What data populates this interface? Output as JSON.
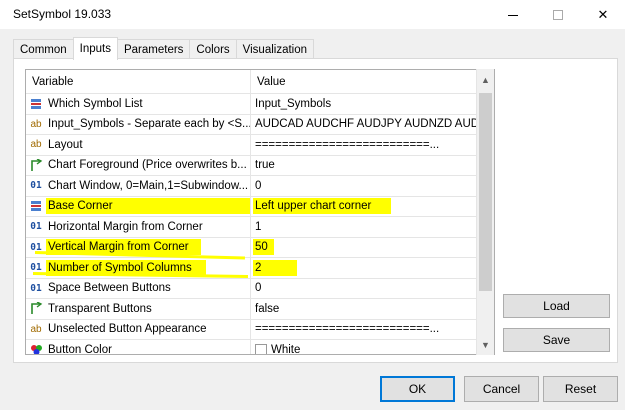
{
  "window": {
    "title": "SetSymbol 19.033",
    "minimize_icon": "minimize-icon",
    "maximize_icon": "maximize-icon",
    "close_icon": "close-icon",
    "close_glyph": "✕"
  },
  "tabs": [
    {
      "label": "Common",
      "active": false
    },
    {
      "label": "Inputs",
      "active": true
    },
    {
      "label": "Parameters",
      "active": false
    },
    {
      "label": "Colors",
      "active": false
    },
    {
      "label": "Visualization",
      "active": false
    }
  ],
  "grid": {
    "header_variable": "Variable",
    "header_value": "Value",
    "rows": [
      {
        "icon": "list-icon",
        "variable": "Which Symbol List",
        "value": "Input_Symbols"
      },
      {
        "icon": "ab",
        "variable": "Input_Symbols - Separate each by <S...",
        "value": "AUDCAD AUDCHF AUDJPY AUDNZD AUD..."
      },
      {
        "icon": "ab",
        "variable": "Layout",
        "value": "==========================..."
      },
      {
        "icon": "bool-icon",
        "variable": "Chart Foreground (Price overwrites b...",
        "value": "true"
      },
      {
        "icon": "01",
        "variable": "Chart Window, 0=Main,1=Subwindow...",
        "value": "0"
      },
      {
        "icon": "list-icon",
        "variable": "Base Corner",
        "value": "Left upper chart corner"
      },
      {
        "icon": "01",
        "variable": "Horizontal Margin from Corner",
        "value": "1"
      },
      {
        "icon": "01",
        "variable": "Vertical Margin from Corner",
        "value": "50"
      },
      {
        "icon": "01",
        "variable": "Number of Symbol Columns",
        "value": "2"
      },
      {
        "icon": "01",
        "variable": "Space Between Buttons",
        "value": "0"
      },
      {
        "icon": "bool-icon",
        "variable": "Transparent Buttons",
        "value": "false"
      },
      {
        "icon": "ab",
        "variable": "Unselected Button Appearance",
        "value": "==========================..."
      },
      {
        "icon": "color-icon",
        "variable": "Button Color",
        "value": "White"
      }
    ]
  },
  "buttons": {
    "load": "Load",
    "save": "Save",
    "ok": "OK",
    "cancel": "Cancel",
    "reset": "Reset"
  },
  "colors": {
    "highlight": "#ffff00",
    "accent": "#0078d7"
  }
}
